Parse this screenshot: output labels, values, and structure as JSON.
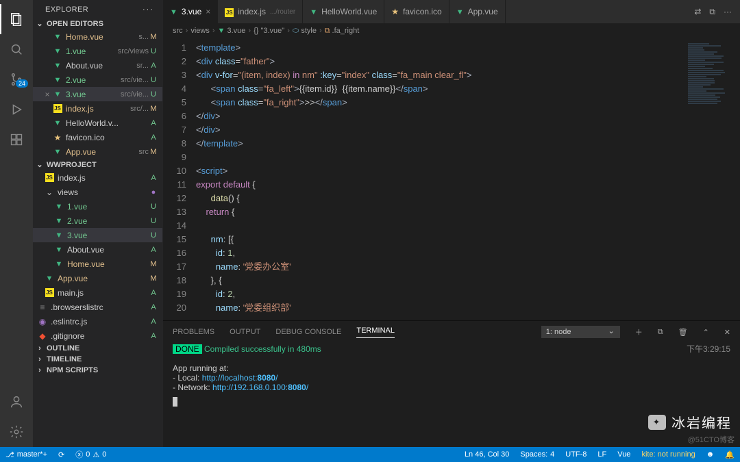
{
  "sidebar": {
    "title": "EXPLORER",
    "openEditorsLabel": "OPEN EDITORS",
    "projectLabel": "WWPROJECT",
    "outlineLabel": "OUTLINE",
    "timelineLabel": "TIMELINE",
    "npmLabel": "NPM SCRIPTS",
    "openEditors": [
      {
        "name": "Home.vue",
        "sub": "s...",
        "stat": "M",
        "icon": "vue"
      },
      {
        "name": "1.vue",
        "sub": "src/views",
        "stat": "U",
        "icon": "vue"
      },
      {
        "name": "About.vue",
        "sub": "sr...",
        "stat": "A",
        "icon": "vue"
      },
      {
        "name": "2.vue",
        "sub": "src/vie...",
        "stat": "U",
        "icon": "vue"
      },
      {
        "name": "3.vue",
        "sub": "src/vie...",
        "stat": "U",
        "icon": "vue",
        "active": true
      },
      {
        "name": "index.js",
        "sub": "src/...",
        "stat": "M",
        "icon": "js"
      },
      {
        "name": "HelloWorld.v...",
        "sub": "",
        "stat": "A",
        "icon": "vue"
      },
      {
        "name": "favicon.ico",
        "sub": "",
        "stat": "A",
        "icon": "star"
      },
      {
        "name": "App.vue",
        "sub": "src",
        "stat": "M",
        "icon": "vue"
      }
    ],
    "tree": [
      {
        "name": "index.js",
        "stat": "A",
        "icon": "js",
        "indent": 16
      },
      {
        "name": "views",
        "stat": "●",
        "icon": "chev",
        "indent": 16,
        "folder": true
      },
      {
        "name": "1.vue",
        "stat": "U",
        "icon": "vue",
        "indent": 30
      },
      {
        "name": "2.vue",
        "stat": "U",
        "icon": "vue",
        "indent": 30
      },
      {
        "name": "3.vue",
        "stat": "U",
        "icon": "vue",
        "indent": 30,
        "sel": true
      },
      {
        "name": "About.vue",
        "stat": "A",
        "icon": "vue",
        "indent": 30
      },
      {
        "name": "Home.vue",
        "stat": "M",
        "icon": "vue",
        "indent": 30
      },
      {
        "name": "App.vue",
        "stat": "M",
        "icon": "vue",
        "indent": 16
      },
      {
        "name": "main.js",
        "stat": "A",
        "icon": "js",
        "indent": 16
      },
      {
        "name": ".browserslistrc",
        "stat": "A",
        "icon": "lines",
        "indent": 6
      },
      {
        "name": ".eslintrc.js",
        "stat": "A",
        "icon": "eslint",
        "indent": 6
      },
      {
        "name": ".gitignore",
        "stat": "A",
        "icon": "git",
        "indent": 6
      }
    ]
  },
  "activity": {
    "badge": "24"
  },
  "tabs": [
    {
      "label": "3.vue",
      "icon": "vue",
      "active": true,
      "close": "×"
    },
    {
      "label": "index.js",
      "sub": ".../router",
      "icon": "js"
    },
    {
      "label": "HelloWorld.vue",
      "icon": "vue"
    },
    {
      "label": "favicon.ico",
      "icon": "star"
    },
    {
      "label": "App.vue",
      "icon": "vue"
    }
  ],
  "breadcrumb": [
    "src",
    "views",
    "3.vue",
    "{} \"3.vue\"",
    "style",
    ".fa_right"
  ],
  "code": {
    "lines": [
      {
        "n": 1,
        "html": "<span class='t-pnc'>&lt;</span><span class='t-tag'>template</span><span class='t-pnc'>&gt;</span>"
      },
      {
        "n": 2,
        "html": "<span class='t-pnc'>&lt;</span><span class='t-tag'>div</span> <span class='t-attr'>class</span>=<span class='t-str'>\"father\"</span><span class='t-pnc'>&gt;</span>"
      },
      {
        "n": 3,
        "html": "<span class='t-pnc'>&lt;</span><span class='t-tag'>div</span> <span class='t-attr'>v-for</span>=<span class='t-str'>\"(item, index) </span><span class='t-kw'>in</span><span class='t-str'> nm\"</span> <span class='t-attr'>:key</span>=<span class='t-str'>\"index\"</span> <span class='t-attr'>class</span>=<span class='t-str'>\"fa_main clear_fl\"</span><span class='t-pnc'>&gt;</span>"
      },
      {
        "n": 4,
        "html": "      <span class='t-pnc'>&lt;</span><span class='t-tag'>span</span> <span class='t-attr'>class</span>=<span class='t-str'>\"fa_left\"</span><span class='t-pnc'>&gt;</span>{{item.id}}  {{item.name}}<span class='t-pnc'>&lt;/</span><span class='t-tag'>span</span><span class='t-pnc'>&gt;</span>"
      },
      {
        "n": 5,
        "html": "      <span class='t-pnc'>&lt;</span><span class='t-tag'>span</span> <span class='t-attr'>class</span>=<span class='t-str'>\"fa_right\"</span><span class='t-pnc'>&gt;</span>&gt;&gt;<span class='t-pnc'>&lt;/</span><span class='t-tag'>span</span><span class='t-pnc'>&gt;</span>"
      },
      {
        "n": 6,
        "html": "<span class='t-pnc'>&lt;/</span><span class='t-tag'>div</span><span class='t-pnc'>&gt;</span>"
      },
      {
        "n": 7,
        "html": "<span class='t-pnc'>&lt;/</span><span class='t-tag'>div</span><span class='t-pnc'>&gt;</span>"
      },
      {
        "n": 8,
        "html": "<span class='t-pnc'>&lt;/</span><span class='t-tag'>template</span><span class='t-pnc'>&gt;</span>"
      },
      {
        "n": 9,
        "html": ""
      },
      {
        "n": 10,
        "html": "<span class='t-pnc'>&lt;</span><span class='t-tag'>script</span><span class='t-pnc'>&gt;</span>"
      },
      {
        "n": 11,
        "html": "<span class='t-kw'>export</span> <span class='t-kw'>default</span> {"
      },
      {
        "n": 12,
        "html": "      <span class='t-fn'>data</span>() {"
      },
      {
        "n": 13,
        "html": "    <span class='t-kw'>return</span> {"
      },
      {
        "n": 14,
        "html": ""
      },
      {
        "n": 15,
        "html": "      <span class='t-attr'>nm</span>: [{"
      },
      {
        "n": 16,
        "html": "        <span class='t-attr'>id</span>: <span class='t-num'>1</span>,"
      },
      {
        "n": 17,
        "html": "        <span class='t-attr'>name</span>: <span class='t-str'>'党委办公室'</span>"
      },
      {
        "n": 18,
        "html": "      }, {"
      },
      {
        "n": 19,
        "html": "        <span class='t-attr'>id</span>: <span class='t-num'>2</span>,"
      },
      {
        "n": 20,
        "html": "        <span class='t-attr'>name</span>: <span class='t-str'>'党委组织部'</span>"
      }
    ]
  },
  "panel": {
    "tabs": [
      "PROBLEMS",
      "OUTPUT",
      "DEBUG CONSOLE",
      "TERMINAL"
    ],
    "activeTab": "TERMINAL",
    "select": "1: node",
    "doneLabel": "DONE",
    "compiled": " Compiled successfully in 480ms",
    "time": "下午3:29:15",
    "appRunning": "App running at:",
    "localLabel": "- Local:   ",
    "localUrl": "http://localhost:",
    "localPort": "8080",
    "netLabel": "- Network: ",
    "netUrl": "http://192.168.0.100:",
    "netPort": "8080"
  },
  "status": {
    "branch": "master*+",
    "errors": "0",
    "warnings": "0",
    "cursor": "Ln 46, Col 30",
    "spacesLabel": "Spaces:",
    "spaces": "4",
    "enc": "UTF-8",
    "eol": "LF",
    "lang": "Vue",
    "kite": "kite: not running"
  },
  "watermark": "冰岩编程",
  "cto": "@51CTO博客"
}
